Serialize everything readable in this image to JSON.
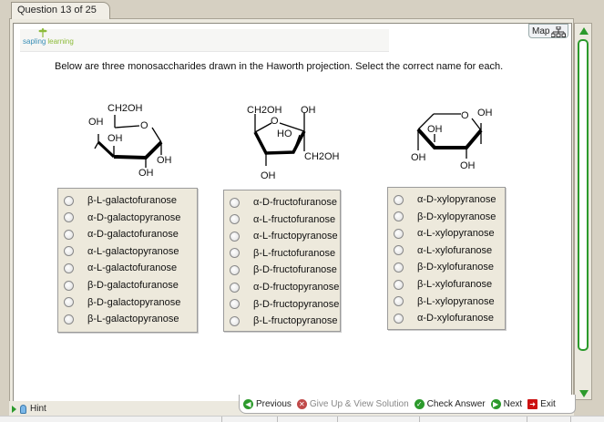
{
  "tab": {
    "label": "Question 13 of 25"
  },
  "logo": {
    "part1": "sapling",
    "part2": "learning"
  },
  "map_button": {
    "label": "Map"
  },
  "instructions": "Below are three monosaccharides drawn in the Haworth projection.  Select the correct name for each.",
  "structures": [
    {
      "labels": [
        "CH2OH",
        "OH",
        "OH",
        "O",
        "OH",
        "OH"
      ]
    },
    {
      "labels": [
        "CH2OH",
        "OH",
        "O",
        "HO",
        "CH2OH",
        "OH"
      ]
    },
    {
      "labels": [
        "O",
        "OH",
        "OH",
        "OH",
        "OH"
      ]
    }
  ],
  "questions": [
    {
      "options": [
        "β-L-galactofuranose",
        "α-D-galactopyranose",
        "α-D-galactofuranose",
        "α-L-galactopyranose",
        "α-L-galactofuranose",
        "β-D-galactofuranose",
        "β-D-galactopyranose",
        "β-L-galactopyranose"
      ]
    },
    {
      "options": [
        "α-D-fructofuranose",
        "α-L-fructofuranose",
        "α-L-fructopyranose",
        "β-L-fructofuranose",
        "β-D-fructofuranose",
        "α-D-fructopyranose",
        "β-D-fructopyranose",
        "β-L-fructopyranose"
      ]
    },
    {
      "options": [
        "α-D-xylopyranose",
        "β-D-xylopyranose",
        "α-L-xylopyranose",
        "α-L-xylofuranose",
        "β-D-xylofuranose",
        "β-L-xylofuranose",
        "β-L-xylopyranose",
        "α-D-xylofuranose"
      ]
    }
  ],
  "hint": {
    "label": "Hint"
  },
  "toolbar": {
    "previous": "Previous",
    "give_up": "Give Up & View Solution",
    "check": "Check Answer",
    "next": "Next",
    "exit": "Exit"
  },
  "colors": {
    "accent_green": "#2c9a2c",
    "exit_red": "#cc1111"
  }
}
